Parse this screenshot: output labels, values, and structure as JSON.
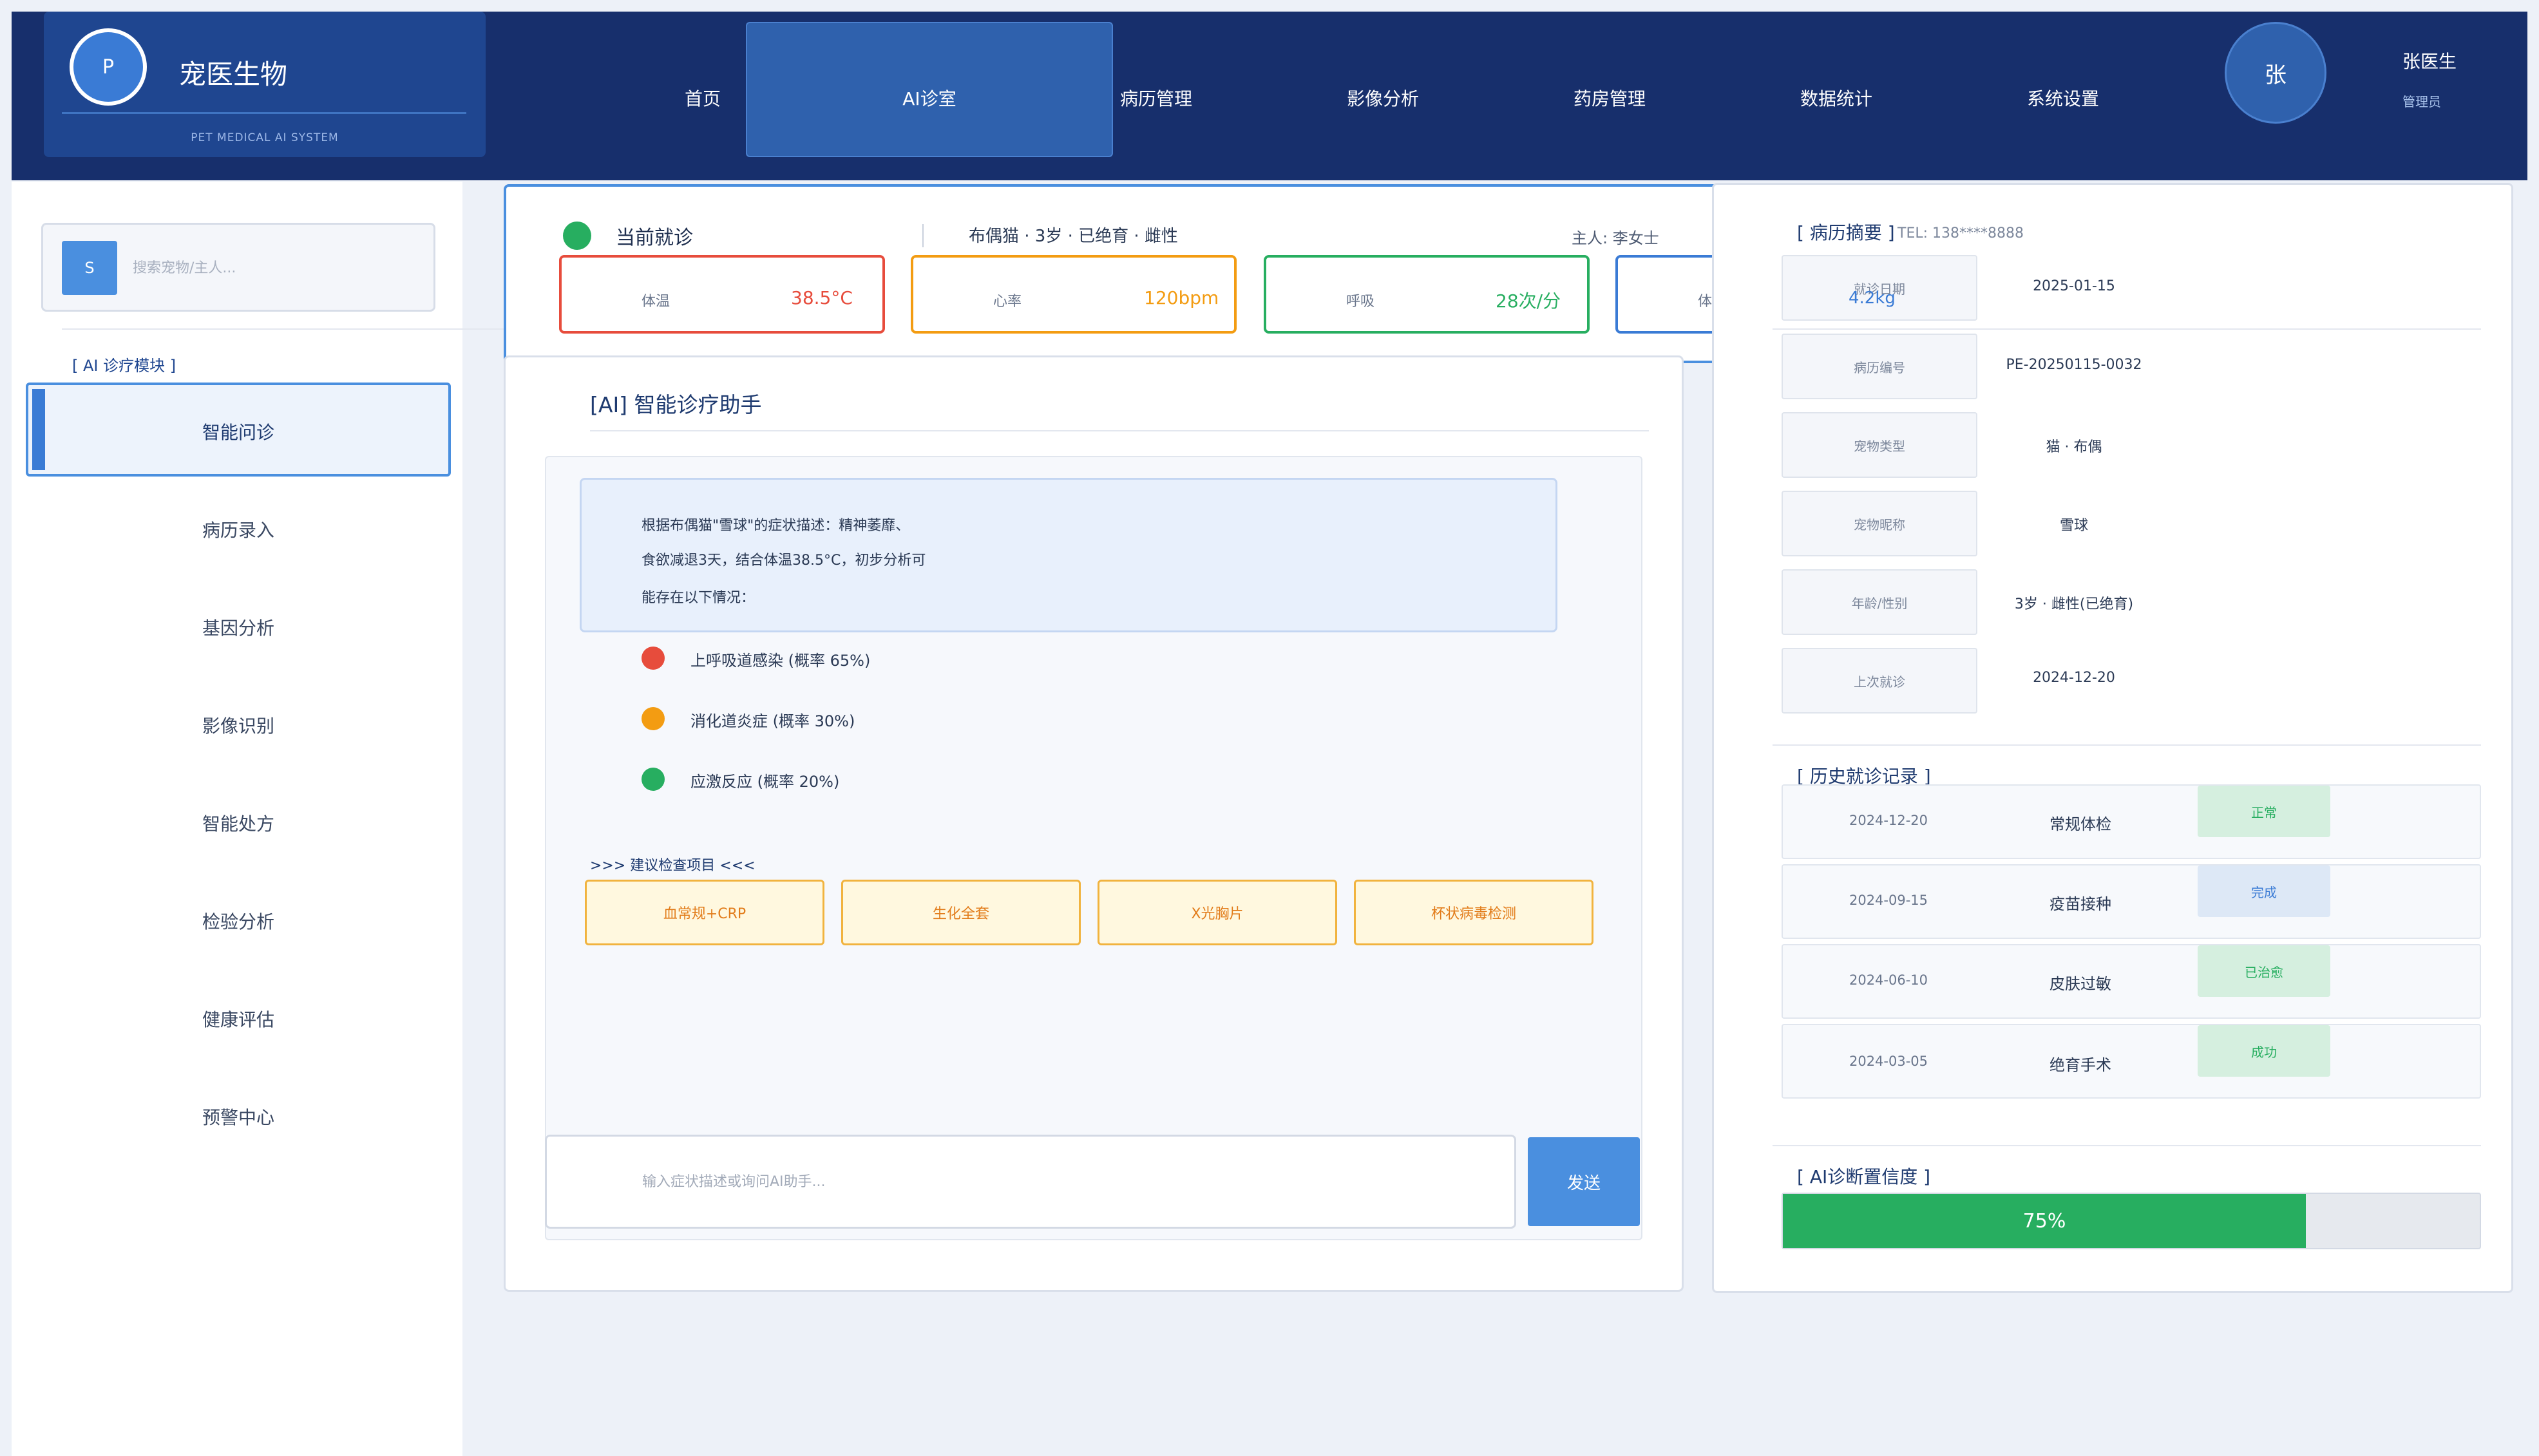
{
  "header": {
    "brand_logo_letter": "P",
    "brand_name": "宠医生物",
    "brand_sub": "PET MEDICAL AI SYSTEM",
    "nav": [
      "首页",
      "AI诊室",
      "病历管理",
      "影像分析",
      "药房管理",
      "数据统计",
      "系统设置"
    ],
    "active_nav": "AI诊室",
    "avatar_letter": "张",
    "user_name": "张医生",
    "user_role": "管理员"
  },
  "sidebar": {
    "search_icon_letter": "S",
    "search_placeholder": "搜索宠物/主人...",
    "module_title": "[ AI 诊疗模块 ]",
    "items": [
      "智能问诊",
      "病历录入",
      "基因分析",
      "影像识别",
      "智能处方",
      "检验分析",
      "健康评估",
      "预警中心"
    ],
    "active_item": "智能问诊"
  },
  "patient": {
    "current_label": "当前就诊",
    "pet_info": "布偶猫 · 3岁 · 已绝育 · 雌性",
    "owner": "主人: 李女士",
    "vitals": [
      {
        "label": "体温",
        "value": "38.5°C",
        "color": "#e74c3c"
      },
      {
        "label": "心率",
        "value": "120bpm",
        "color": "#f39c12"
      },
      {
        "label": "呼吸",
        "value": "28次/分",
        "color": "#27ae60"
      },
      {
        "label": "体重",
        "value": "4.2kg",
        "color": "#3a7bd5"
      }
    ]
  },
  "chat": {
    "title": "[AI] 智能诊疗助手",
    "bubble_lines": [
      "根据布偶猫\"雪球\"的症状描述：精神萎靡、",
      "食欲减退3天，结合体温38.5°C，初步分析可",
      "能存在以下情况："
    ],
    "diagnoses": [
      {
        "text": "上呼吸道感染 (概率 65%)",
        "color": "#e74c3c"
      },
      {
        "text": "消化道炎症 (概率 30%)",
        "color": "#f39c12"
      },
      {
        "text": "应激反应 (概率 20%)",
        "color": "#27ae60"
      }
    ],
    "tests_title": ">>> 建议检查项目 <<<",
    "tests": [
      "血常规+CRP",
      "生化全套",
      "X光胸片",
      "杯状病毒检测"
    ],
    "input_placeholder": "输入症状描述或询问AI助手...",
    "send_label": "发送"
  },
  "record": {
    "summary_title": "[ 病历摘要 ]",
    "tel": "TEL: 138****8888",
    "rows": [
      {
        "label": "就诊日期",
        "value": "2025-01-15"
      },
      {
        "label": "病历编号",
        "value": "PE-20250115-0032"
      },
      {
        "label": "宠物类型",
        "value": "猫 · 布偶"
      },
      {
        "label": "宠物昵称",
        "value": "雪球"
      },
      {
        "label": "年龄/性别",
        "value": "3岁 · 雌性(已绝育)"
      },
      {
        "label": "上次就诊",
        "value": "2024-12-20"
      }
    ],
    "history_title": "[ 历史就诊记录 ]",
    "history": [
      {
        "date": "2024-12-20",
        "item": "常规体检",
        "status": "正常",
        "status_bg": "#d5efdf",
        "status_color": "#27ae60"
      },
      {
        "date": "2024-09-15",
        "item": "疫苗接种",
        "status": "完成",
        "status_bg": "#dde8f6",
        "status_color": "#3a7bd5"
      },
      {
        "date": "2024-06-10",
        "item": "皮肤过敏",
        "status": "已治愈",
        "status_bg": "#d5efdf",
        "status_color": "#27ae60"
      },
      {
        "date": "2024-03-05",
        "item": "绝育手术",
        "status": "成功",
        "status_bg": "#d5efdf",
        "status_color": "#27ae60"
      }
    ],
    "confidence_title": "[ AI诊断置信度 ]",
    "confidence_value": 0.75,
    "confidence_label": "75%"
  },
  "colors": {
    "header_bg": "#172f6c",
    "accent": "#3a7bd5",
    "success": "#27ae60"
  }
}
